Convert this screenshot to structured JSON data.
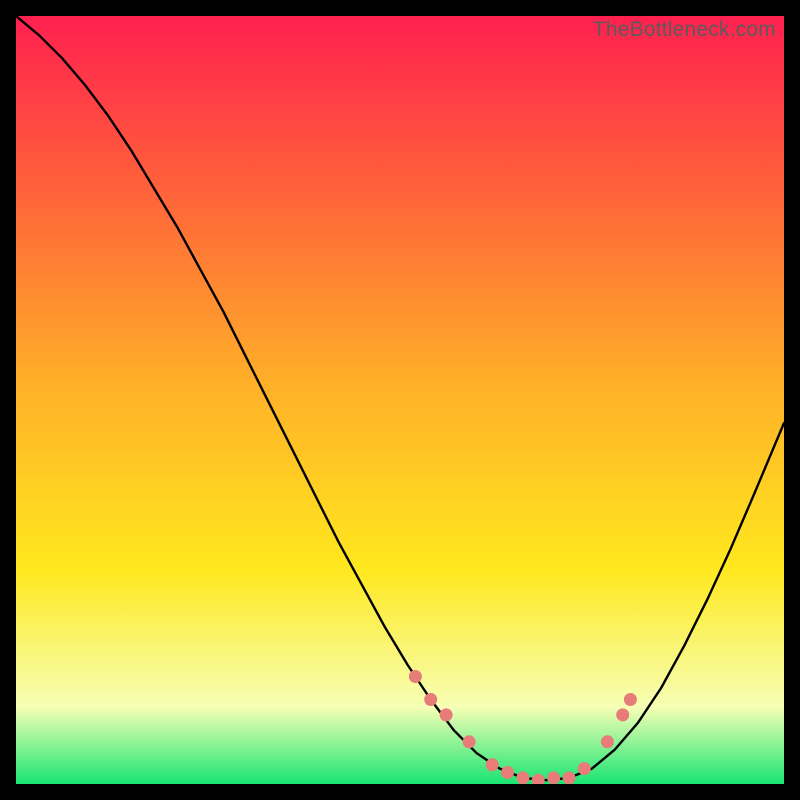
{
  "watermark": "TheBottleneck.com",
  "colors": {
    "gradient_top": "#ff2050",
    "gradient_mid_red": "#ff5a3c",
    "gradient_orange": "#ffb028",
    "gradient_yellow": "#ffe81e",
    "gradient_pale": "#f6ffb5",
    "gradient_green": "#18e572",
    "curve": "#000000",
    "markers": "#e77c78",
    "frame_bg": "#000000"
  },
  "chart_data": {
    "type": "line",
    "title": "",
    "xlabel": "",
    "ylabel": "",
    "xlim": [
      0,
      100
    ],
    "ylim": [
      0,
      100
    ],
    "series": [
      {
        "name": "bottleneck-curve",
        "x": [
          0,
          3,
          6,
          9,
          12,
          15,
          18,
          21,
          24,
          27,
          30,
          33,
          36,
          39,
          42,
          45,
          48,
          51,
          54,
          57,
          60,
          63,
          66,
          69,
          72,
          75,
          78,
          81,
          84,
          87,
          90,
          93,
          96,
          100
        ],
        "y": [
          100,
          97.5,
          94.5,
          91,
          87,
          82.5,
          77.5,
          72.5,
          67,
          61.5,
          55.5,
          49.5,
          43.5,
          37.5,
          31.5,
          26,
          20.5,
          15.5,
          11,
          7,
          4,
          2,
          0.8,
          0.5,
          0.8,
          2,
          4.5,
          8,
          12.5,
          18,
          24,
          30.5,
          37.5,
          47
        ]
      }
    ],
    "markers": {
      "name": "highlight-points",
      "x": [
        52,
        54,
        56,
        59,
        62,
        64,
        66,
        68,
        70,
        72,
        74,
        77,
        79,
        80
      ],
      "y": [
        14,
        11,
        9,
        5.5,
        2.5,
        1.5,
        0.8,
        0.5,
        0.8,
        0.8,
        2,
        5.5,
        9,
        11
      ]
    }
  }
}
